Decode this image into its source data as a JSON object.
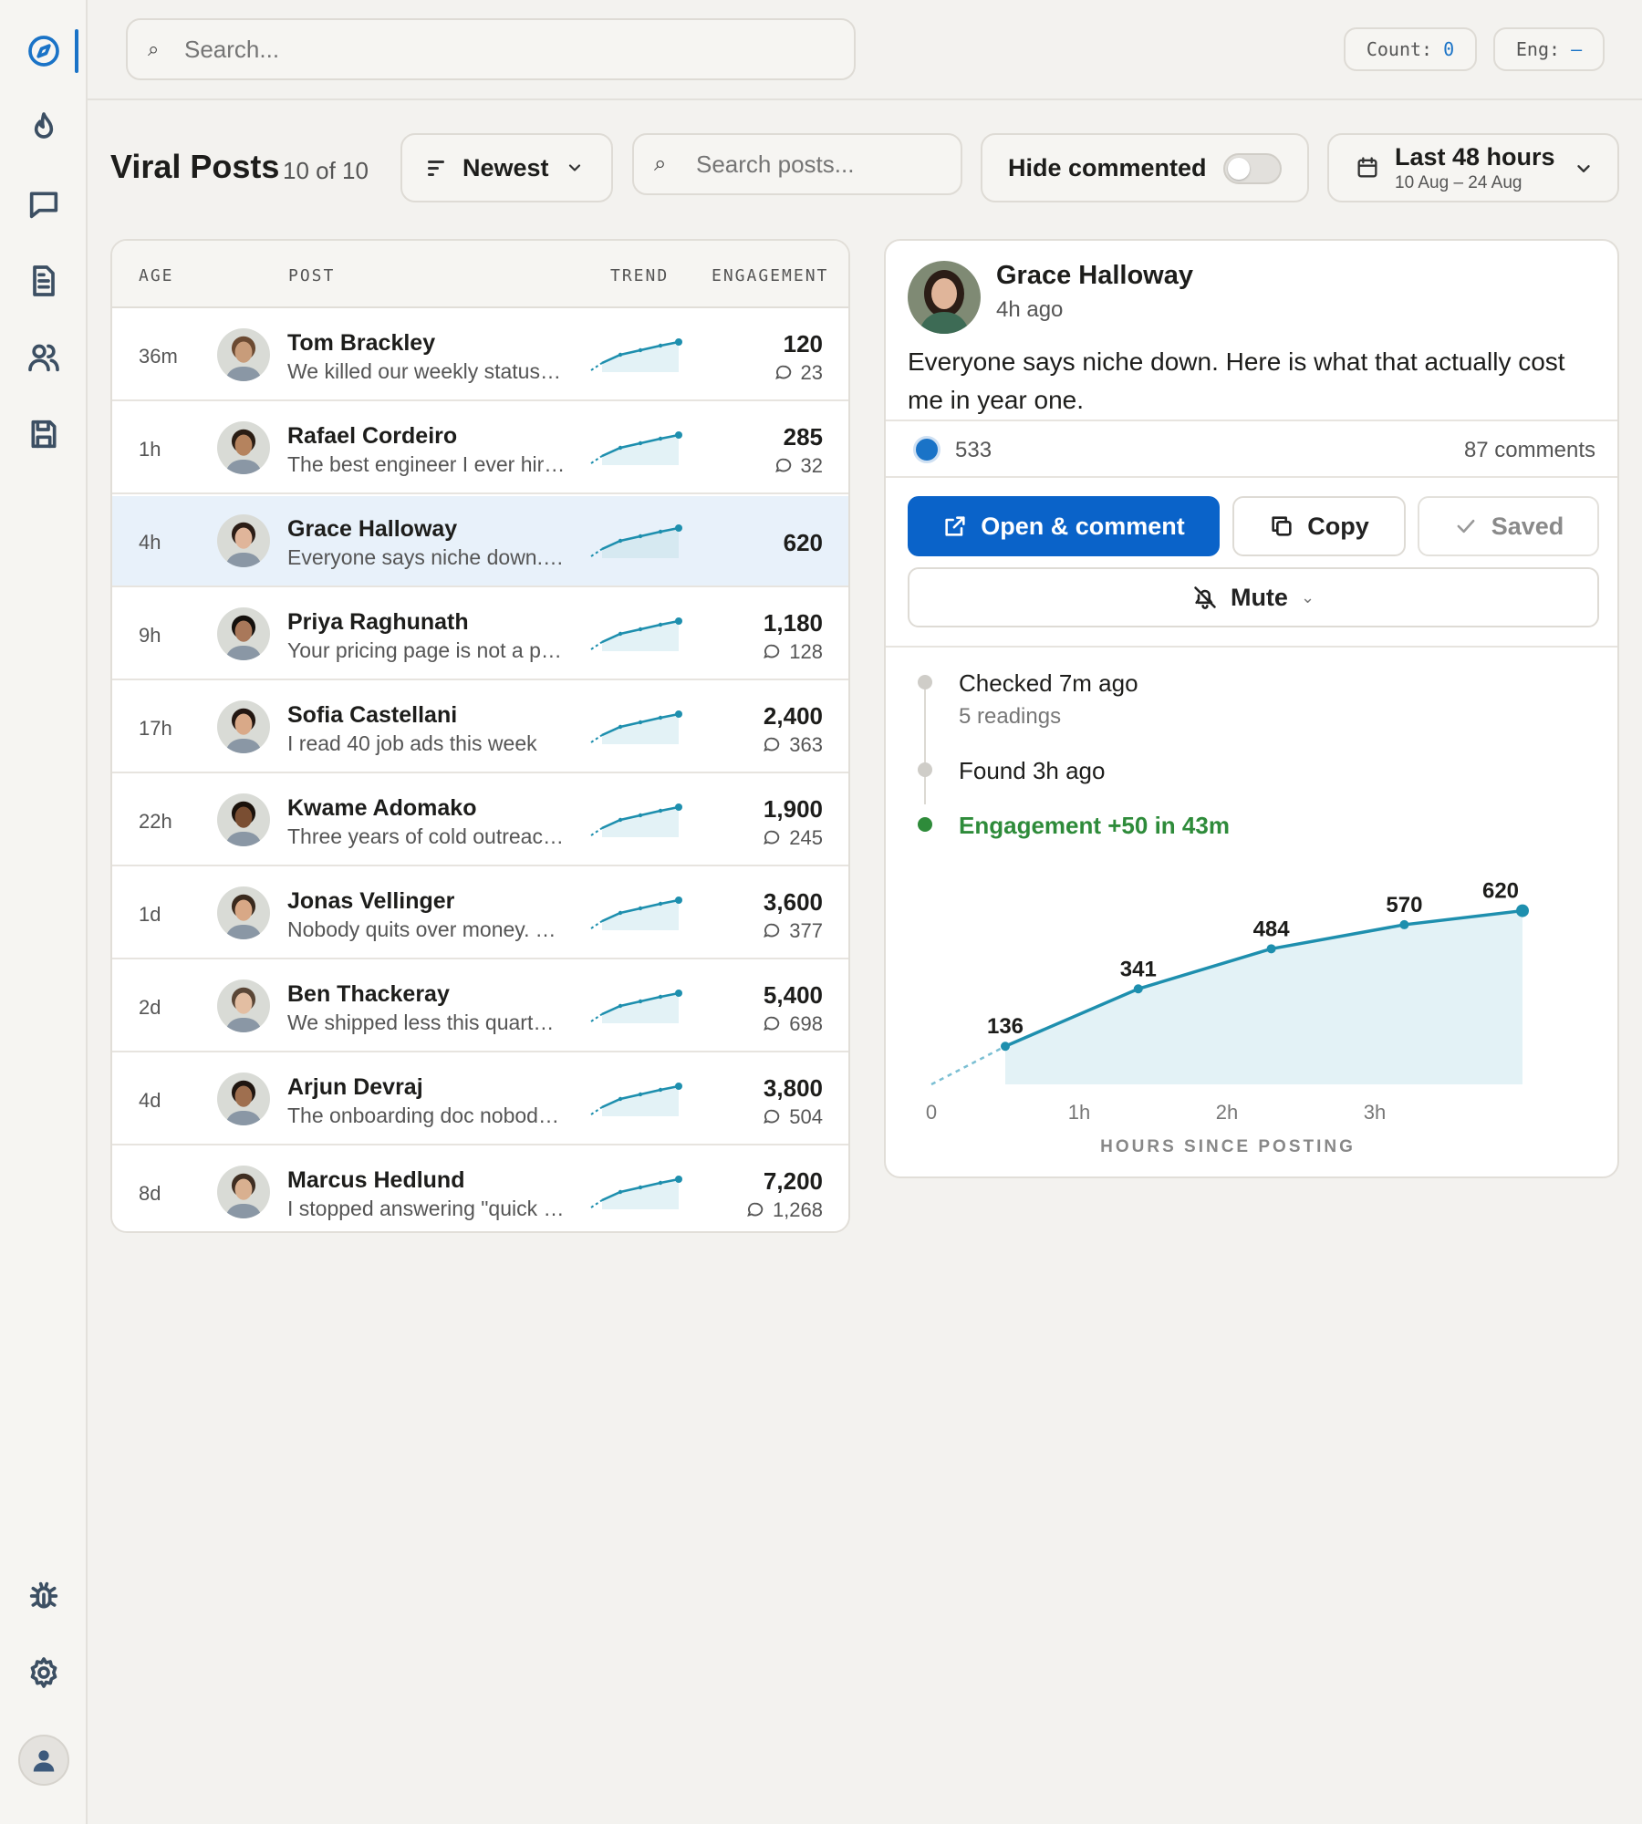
{
  "topbar": {
    "search_placeholder": "Search...",
    "count_label": "Count:",
    "count_value": "0",
    "eng_label": "Eng:",
    "eng_value": "–"
  },
  "header": {
    "title": "Viral Posts",
    "count": "10 of 10",
    "sort_label": "Newest",
    "search_placeholder": "Search posts...",
    "hide_label": "Hide commented",
    "hide_on": false,
    "date_main": "Last 48 hours",
    "date_sub": "10 Aug – 24 Aug"
  },
  "table": {
    "columns": [
      "AGE",
      "POST",
      "TREND",
      "ENGAGEMENT"
    ],
    "rows": [
      {
        "age": "36m",
        "name": "Tom Brackley",
        "snippet": "We killed our weekly status meeting",
        "engagement": "120",
        "comments": "23",
        "selected": false,
        "skin": "#c89c7a",
        "hair": "#6b4a32"
      },
      {
        "age": "1h",
        "name": "Rafael Cordeiro",
        "snippet": "The best engineer I ever hired",
        "engagement": "285",
        "comments": "32",
        "selected": false,
        "skin": "#b5835e",
        "hair": "#2a1d14"
      },
      {
        "age": "4h",
        "name": "Grace Halloway",
        "snippet": "Everyone says niche down. Here is what",
        "engagement": "620",
        "comments": "",
        "selected": true,
        "skin": "#e0b59a",
        "hair": "#2b1d16"
      },
      {
        "age": "9h",
        "name": "Priya Raghunath",
        "snippet": "Your pricing page is not a pricing page",
        "engagement": "1,180",
        "comments": "128",
        "selected": false,
        "skin": "#a9785a",
        "hair": "#14100d"
      },
      {
        "age": "17h",
        "name": "Sofia Castellani",
        "snippet": "I read 40 job ads this week",
        "engagement": "2,400",
        "comments": "363",
        "selected": false,
        "skin": "#d9a988",
        "hair": "#221611"
      },
      {
        "age": "22h",
        "name": "Kwame Adomako",
        "snippet": "Three years of cold outreach taught me",
        "engagement": "1,900",
        "comments": "245",
        "selected": false,
        "skin": "#7a4e32",
        "hair": "#1a110b"
      },
      {
        "age": "1d",
        "name": "Jonas Vellinger",
        "snippet": "Nobody quits over money. They quit",
        "engagement": "3,600",
        "comments": "377",
        "selected": false,
        "skin": "#d8a886",
        "hair": "#3a2a1e"
      },
      {
        "age": "2d",
        "name": "Ben Thackeray",
        "snippet": "We shipped less this quarter and grew",
        "engagement": "5,400",
        "comments": "698",
        "selected": false,
        "skin": "#e3bea2",
        "hair": "#5a4636"
      },
      {
        "age": "4d",
        "name": "Arjun Devraj",
        "snippet": "The onboarding doc nobody reads",
        "engagement": "3,800",
        "comments": "504",
        "selected": false,
        "skin": "#9f6f4f",
        "hair": "#1f1510"
      },
      {
        "age": "8d",
        "name": "Marcus Hedlund",
        "snippet": "I stopped answering \"quick questions\"",
        "engagement": "7,200",
        "comments": "1,268",
        "selected": false,
        "skin": "#d9b090",
        "hair": "#3f2e22"
      }
    ]
  },
  "detail": {
    "name": "Grace Halloway",
    "time": "4h ago",
    "text": "Everyone says niche down. Here is what that actually cost me in year one.",
    "likes": "533",
    "comments": "87 comments",
    "open_label": "Open & comment",
    "copy_label": "Copy",
    "saved_label": "Saved",
    "mute_label": "Mute",
    "timeline": {
      "checked": "Checked 7m ago",
      "readings": "5 readings",
      "found": "Found 3h ago",
      "engagement": "Engagement +50 in 43m"
    }
  },
  "colors": {
    "accent": "#0a63c9",
    "trend_line": "#1e8fae",
    "trend_fill": "#e3f2f6",
    "positive": "#2e8b3a"
  },
  "chart_data": {
    "type": "area",
    "x": [
      0.5,
      1.4,
      2.3,
      3.2,
      4.0
    ],
    "y": [
      136,
      341,
      484,
      570,
      620
    ],
    "point_labels": [
      "136",
      "341",
      "484",
      "570",
      "620"
    ],
    "xlabel": "HOURS SINCE POSTING",
    "x_ticks": [
      0,
      1,
      2,
      3
    ],
    "x_tick_labels": [
      "0",
      "1h",
      "2h",
      "3h"
    ],
    "xlim": [
      0,
      4
    ],
    "ylim": [
      0,
      700
    ],
    "grid": false
  }
}
